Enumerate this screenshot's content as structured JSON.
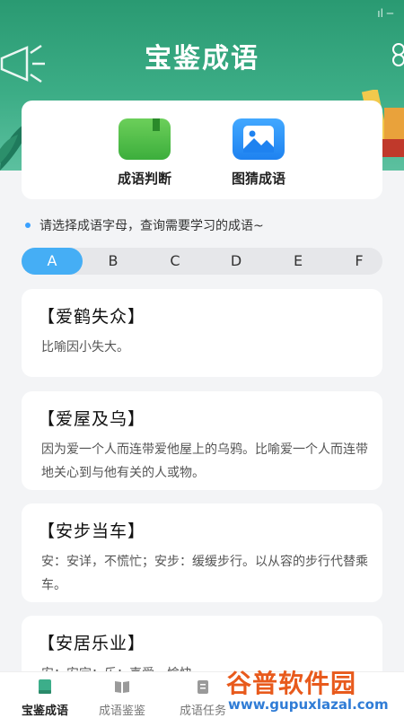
{
  "app": {
    "title": "宝鉴成语"
  },
  "features": [
    {
      "label": "成语判断",
      "icon": "book-icon"
    },
    {
      "label": "图猜成语",
      "icon": "image-icon"
    }
  ],
  "hint": "请选择成语字母，查询需要学习的成语~",
  "tabs": [
    "A",
    "B",
    "C",
    "D",
    "E",
    "F"
  ],
  "active_tab": "A",
  "idioms": [
    {
      "word": "【爱鹤失众】",
      "meaning": "比喻因小失大。"
    },
    {
      "word": "【爱屋及乌】",
      "meaning": "因为爱一个人而连带爱他屋上的乌鸦。比喻爱一个人而连带地关心到与他有关的人或物。"
    },
    {
      "word": "【安步当车】",
      "meaning": "安：安详，不慌忙；安步：缓缓步行。以从容的步行代替乘车。"
    },
    {
      "word": "【安居乐业】",
      "meaning": "安：安定；乐：喜爱，愉快"
    }
  ],
  "bottom_nav": [
    {
      "label": "宝鉴成语",
      "icon": "book-stack-icon",
      "active": true
    },
    {
      "label": "成语鉴鉴",
      "icon": "open-book-icon",
      "active": false
    },
    {
      "label": "成语任务",
      "icon": "clipboard-icon",
      "active": false
    }
  ],
  "watermark": {
    "brand": "谷普软件园",
    "url": "www.gupuxlazal.com"
  },
  "colors": {
    "header": "#2a9a72",
    "accent": "#45aef5",
    "watermark_brand": "#e85a1c",
    "watermark_url": "#2f7cd6"
  }
}
